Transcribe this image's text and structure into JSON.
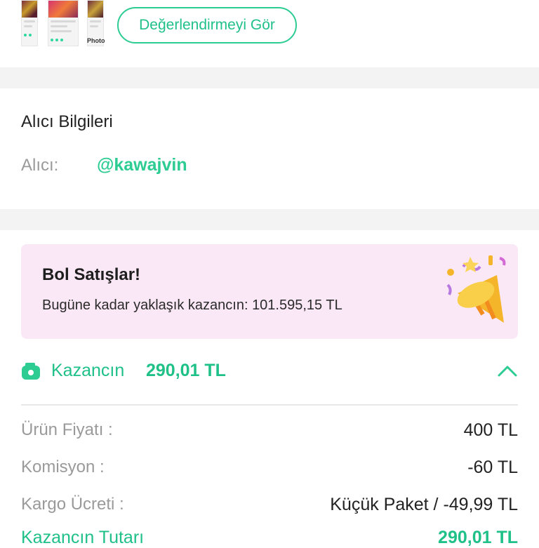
{
  "top": {
    "thumbnail_caption": "Photo",
    "review_button_label": "Değerlendirmeyi Gör"
  },
  "buyer": {
    "section_title": "Alıcı Bilgileri",
    "label": "Alıcı:",
    "handle": "@kawajvin"
  },
  "promo": {
    "title": "Bol Satışlar!",
    "text": "Bugüne kadar yaklaşık kazancın: 101.595,15 TL",
    "icon": "party-popper-icon"
  },
  "earnings": {
    "label": "Kazancın",
    "value": "290,01 TL",
    "icon": "wallet-icon",
    "toggle_icon": "chevron-up-icon",
    "lines": [
      {
        "label": "Ürün Fiyatı :",
        "value": "400 TL"
      },
      {
        "label": "Komisyon :",
        "value": "-60 TL"
      },
      {
        "label": "Kargo Ücreti :",
        "value": "Küçük Paket / -49,99 TL"
      }
    ],
    "total_label": "Kazancın Tutarı",
    "total_value": "290,01 TL"
  },
  "colors": {
    "accent": "#2dcc93",
    "promo_bg": "#fbe8f6",
    "band": "#f3f3f3"
  }
}
